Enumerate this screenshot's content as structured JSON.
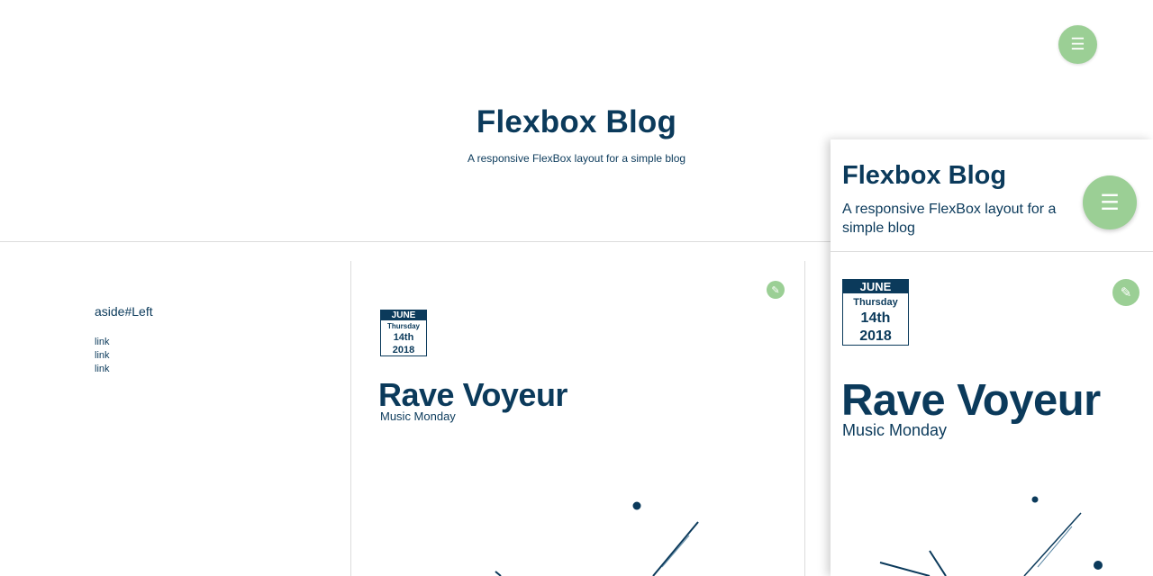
{
  "header": {
    "title": "Flexbox Blog",
    "subtitle": "A responsive FlexBox layout for a simple blog",
    "menu_icon": "hamburger-icon"
  },
  "aside_left": {
    "title": "aside#Left",
    "links": [
      "link",
      "link",
      "link"
    ]
  },
  "post": {
    "date": {
      "month": "JUNE",
      "weekday": "Thursday",
      "day": "14th",
      "year": "2018"
    },
    "title": "Rave Voyeur",
    "category": "Music Monday",
    "edit_icon": "pencil-icon"
  },
  "mobile_preview": {
    "title": "Flexbox Blog",
    "subtitle": "A responsive FlexBox layout for a simple blog",
    "menu_icon": "hamburger-icon",
    "post": {
      "date": {
        "month": "JUNE",
        "weekday": "Thursday",
        "day": "14th",
        "year": "2018"
      },
      "title": "Rave Voyeur",
      "category": "Music Monday",
      "edit_icon": "pencil-icon"
    }
  },
  "colors": {
    "primary": "#0b3a5b",
    "accent": "#9bcf95",
    "divider": "#dcdcdc",
    "background": "#ffffff"
  }
}
